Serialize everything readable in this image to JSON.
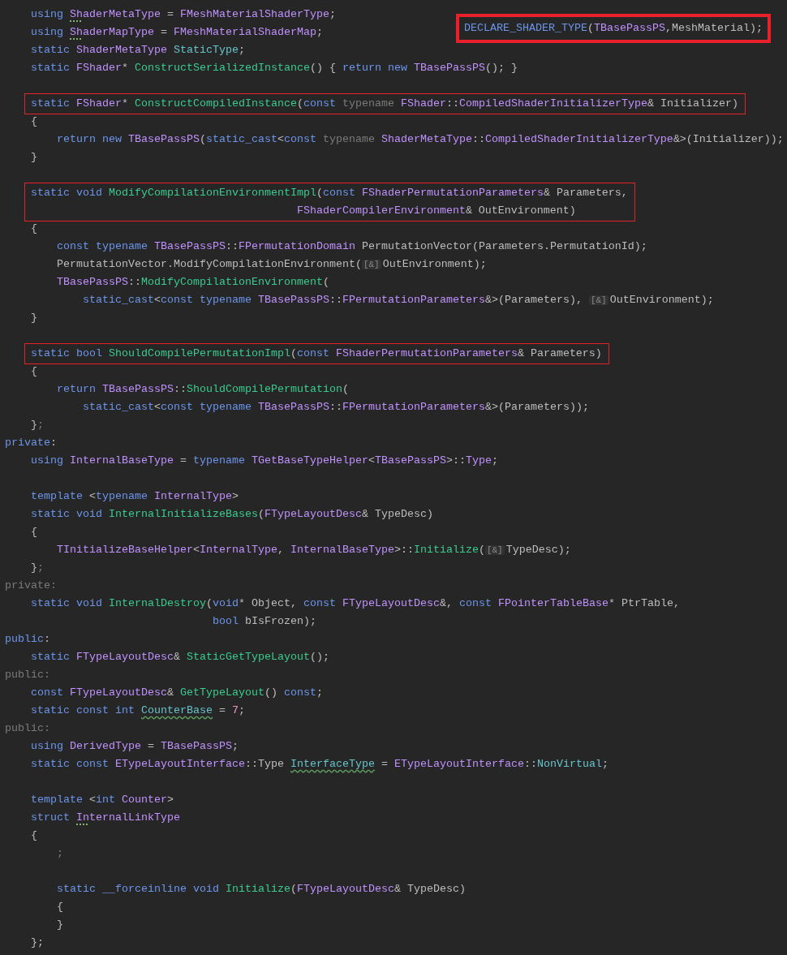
{
  "callout": {
    "tokens": [
      {
        "kind": "macro",
        "text": "DECLARE_SHADER_TYPE"
      },
      {
        "kind": "plain",
        "text": "("
      },
      {
        "kind": "type",
        "text": "TBasePassPS"
      },
      {
        "kind": "plain",
        "text": ",MeshMaterial);"
      }
    ]
  },
  "blocks": [
    {
      "boxed": false,
      "lines": [
        {
          "kind": "code",
          "tokens": [
            {
              "kind": "kw",
              "text": "    using "
            },
            {
              "kind": "type_dotted",
              "text": "Sh"
            },
            {
              "kind": "type",
              "text": "aderMetaType"
            },
            {
              "kind": "plain",
              "text": " = "
            },
            {
              "kind": "type",
              "text": "FMeshMaterialShaderType"
            },
            {
              "kind": "plain",
              "text": ";"
            }
          ]
        },
        {
          "kind": "code",
          "tokens": [
            {
              "kind": "kw",
              "text": "    using "
            },
            {
              "kind": "type_dotted",
              "text": "Sh"
            },
            {
              "kind": "type",
              "text": "aderMapType"
            },
            {
              "kind": "plain",
              "text": " = "
            },
            {
              "kind": "type",
              "text": "FMeshMaterialShaderMap"
            },
            {
              "kind": "plain",
              "text": ";"
            }
          ]
        },
        {
          "kind": "code",
          "tokens": [
            {
              "kind": "kw",
              "text": "    static "
            },
            {
              "kind": "type",
              "text": "ShaderMetaType "
            },
            {
              "kind": "field",
              "text": "StaticType"
            },
            {
              "kind": "plain",
              "text": ";"
            }
          ]
        },
        {
          "kind": "code",
          "tokens": [
            {
              "kind": "kw",
              "text": "    static "
            },
            {
              "kind": "type",
              "text": "FShader"
            },
            {
              "kind": "plain",
              "text": "* "
            },
            {
              "kind": "fn",
              "text": "ConstructSerializedInstance"
            },
            {
              "kind": "plain",
              "text": "() { "
            },
            {
              "kind": "kw",
              "text": "return new "
            },
            {
              "kind": "type",
              "text": "TBasePassPS"
            },
            {
              "kind": "plain",
              "text": "(); }"
            }
          ]
        },
        {
          "kind": "blank"
        }
      ]
    },
    {
      "boxed": true,
      "lines": [
        {
          "kind": "code",
          "tokens": [
            {
              "kind": "kw",
              "text": "    static "
            },
            {
              "kind": "type",
              "text": "FShader"
            },
            {
              "kind": "plain",
              "text": "* "
            },
            {
              "kind": "fn",
              "text": "ConstructCompiledInstance"
            },
            {
              "kind": "plain",
              "text": "("
            },
            {
              "kind": "kw",
              "text": "const "
            },
            {
              "kind": "dim",
              "text": "typename "
            },
            {
              "kind": "type",
              "text": "FShader"
            },
            {
              "kind": "plain",
              "text": "::"
            },
            {
              "kind": "type",
              "text": "CompiledShaderInitializerType"
            },
            {
              "kind": "plain",
              "text": "& Initializer)"
            }
          ]
        }
      ]
    },
    {
      "boxed": false,
      "lines": [
        {
          "kind": "code",
          "tokens": [
            {
              "kind": "plain",
              "text": "    {"
            }
          ]
        },
        {
          "kind": "code",
          "tokens": [
            {
              "kind": "kw",
              "text": "        return new "
            },
            {
              "kind": "type",
              "text": "TBasePassPS"
            },
            {
              "kind": "plain",
              "text": "("
            },
            {
              "kind": "kw",
              "text": "static_cast"
            },
            {
              "kind": "plain",
              "text": "<"
            },
            {
              "kind": "kw",
              "text": "const "
            },
            {
              "kind": "dim",
              "text": "typename "
            },
            {
              "kind": "type",
              "text": "ShaderMetaType"
            },
            {
              "kind": "plain",
              "text": "::"
            },
            {
              "kind": "type",
              "text": "CompiledShaderInitializerType"
            },
            {
              "kind": "plain",
              "text": "&>(Initializer));"
            }
          ]
        },
        {
          "kind": "code",
          "tokens": [
            {
              "kind": "plain",
              "text": "    }"
            }
          ]
        },
        {
          "kind": "blank"
        }
      ]
    },
    {
      "boxed": true,
      "lines": [
        {
          "kind": "code",
          "tokens": [
            {
              "kind": "kw",
              "text": "    static void "
            },
            {
              "kind": "fn",
              "text": "ModifyCompilationEnvironmentImpl"
            },
            {
              "kind": "plain",
              "text": "("
            },
            {
              "kind": "kw",
              "text": "const "
            },
            {
              "kind": "type",
              "text": "FShaderPermutationParameters"
            },
            {
              "kind": "plain",
              "text": "& Parameters,"
            }
          ]
        },
        {
          "kind": "code",
          "tokens": [
            {
              "kind": "type",
              "text": "                                             FShaderCompilerEnvironment"
            },
            {
              "kind": "plain",
              "text": "& OutEnvironment)"
            }
          ]
        }
      ]
    },
    {
      "boxed": false,
      "lines": [
        {
          "kind": "code",
          "tokens": [
            {
              "kind": "plain",
              "text": "    {"
            }
          ]
        },
        {
          "kind": "code",
          "tokens": [
            {
              "kind": "kw",
              "text": "        const typename "
            },
            {
              "kind": "type",
              "text": "TBasePassPS"
            },
            {
              "kind": "plain",
              "text": "::"
            },
            {
              "kind": "type",
              "text": "FPermutationDomain"
            },
            {
              "kind": "plain",
              "text": " PermutationVector(Parameters.PermutationId);"
            }
          ]
        },
        {
          "kind": "code",
          "tokens": [
            {
              "kind": "plain",
              "text": "        PermutationVector.ModifyCompilationEnvironment("
            },
            {
              "kind": "hint",
              "text": "[&]"
            },
            {
              "kind": "plain",
              "text": "OutEnvironment);"
            }
          ]
        },
        {
          "kind": "code",
          "tokens": [
            {
              "kind": "type",
              "text": "        TBasePassPS"
            },
            {
              "kind": "plain",
              "text": "::"
            },
            {
              "kind": "fn",
              "text": "ModifyCompilationEnvironment"
            },
            {
              "kind": "plain",
              "text": "("
            }
          ]
        },
        {
          "kind": "code",
          "tokens": [
            {
              "kind": "kw",
              "text": "            static_cast"
            },
            {
              "kind": "plain",
              "text": "<"
            },
            {
              "kind": "kw",
              "text": "const typename "
            },
            {
              "kind": "type",
              "text": "TBasePassPS"
            },
            {
              "kind": "plain",
              "text": "::"
            },
            {
              "kind": "type",
              "text": "FPermutationParameters"
            },
            {
              "kind": "plain",
              "text": "&>(Parameters), "
            },
            {
              "kind": "hint",
              "text": "[&]"
            },
            {
              "kind": "plain",
              "text": "OutEnvironment);"
            }
          ]
        },
        {
          "kind": "code",
          "tokens": [
            {
              "kind": "plain",
              "text": "    }"
            }
          ]
        },
        {
          "kind": "blank"
        }
      ]
    },
    {
      "boxed": true,
      "lines": [
        {
          "kind": "code",
          "tokens": [
            {
              "kind": "kw",
              "text": "    static bool "
            },
            {
              "kind": "fn",
              "text": "ShouldCompilePermutationImpl"
            },
            {
              "kind": "plain",
              "text": "("
            },
            {
              "kind": "kw",
              "text": "const "
            },
            {
              "kind": "type",
              "text": "FShaderPermutationParameters"
            },
            {
              "kind": "plain",
              "text": "& Parameters)"
            }
          ]
        }
      ]
    },
    {
      "boxed": false,
      "lines": [
        {
          "kind": "code",
          "tokens": [
            {
              "kind": "plain",
              "text": "    {"
            }
          ]
        },
        {
          "kind": "code",
          "tokens": [
            {
              "kind": "kw",
              "text": "        return "
            },
            {
              "kind": "type",
              "text": "TBasePassPS"
            },
            {
              "kind": "plain",
              "text": "::"
            },
            {
              "kind": "fn",
              "text": "ShouldCompilePermutation"
            },
            {
              "kind": "plain",
              "text": "("
            }
          ]
        },
        {
          "kind": "code",
          "tokens": [
            {
              "kind": "kw",
              "text": "            static_cast"
            },
            {
              "kind": "plain",
              "text": "<"
            },
            {
              "kind": "kw",
              "text": "const typename "
            },
            {
              "kind": "type",
              "text": "TBasePassPS"
            },
            {
              "kind": "plain",
              "text": "::"
            },
            {
              "kind": "type",
              "text": "FPermutationParameters"
            },
            {
              "kind": "plain",
              "text": "&>(Parameters));"
            }
          ]
        },
        {
          "kind": "code",
          "tokens": [
            {
              "kind": "plain",
              "text": "    }"
            },
            {
              "kind": "dim",
              "text": ";"
            }
          ]
        },
        {
          "kind": "code",
          "tokens": [
            {
              "kind": "kw",
              "text": "private"
            },
            {
              "kind": "plain",
              "text": ":"
            }
          ]
        },
        {
          "kind": "code",
          "tokens": [
            {
              "kind": "kw",
              "text": "    using "
            },
            {
              "kind": "type",
              "text": "InternalBaseType"
            },
            {
              "kind": "plain",
              "text": " = "
            },
            {
              "kind": "kw",
              "text": "typename "
            },
            {
              "kind": "type",
              "text": "TGetBaseTypeHelper"
            },
            {
              "kind": "plain",
              "text": "<"
            },
            {
              "kind": "type",
              "text": "TBasePassPS"
            },
            {
              "kind": "plain",
              "text": ">::"
            },
            {
              "kind": "type",
              "text": "Type"
            },
            {
              "kind": "plain",
              "text": ";"
            }
          ]
        },
        {
          "kind": "blank"
        },
        {
          "kind": "code",
          "tokens": [
            {
              "kind": "kw",
              "text": "    template "
            },
            {
              "kind": "plain",
              "text": "<"
            },
            {
              "kind": "kw",
              "text": "typename "
            },
            {
              "kind": "type",
              "text": "InternalType"
            },
            {
              "kind": "plain",
              "text": ">"
            }
          ]
        },
        {
          "kind": "code",
          "tokens": [
            {
              "kind": "kw",
              "text": "    static void "
            },
            {
              "kind": "fn",
              "text": "InternalInitializeBases"
            },
            {
              "kind": "plain",
              "text": "("
            },
            {
              "kind": "type",
              "text": "FTypeLayoutDesc"
            },
            {
              "kind": "plain",
              "text": "& TypeDesc)"
            }
          ]
        },
        {
          "kind": "code",
          "tokens": [
            {
              "kind": "plain",
              "text": "    {"
            }
          ]
        },
        {
          "kind": "code",
          "tokens": [
            {
              "kind": "type",
              "text": "        TInitializeBaseHelper"
            },
            {
              "kind": "plain",
              "text": "<"
            },
            {
              "kind": "type",
              "text": "InternalType"
            },
            {
              "kind": "plain",
              "text": ", "
            },
            {
              "kind": "type",
              "text": "InternalBaseType"
            },
            {
              "kind": "plain",
              "text": ">::"
            },
            {
              "kind": "fn",
              "text": "Initialize"
            },
            {
              "kind": "plain",
              "text": "("
            },
            {
              "kind": "hint",
              "text": "[&]"
            },
            {
              "kind": "plain",
              "text": "TypeDesc);"
            }
          ]
        },
        {
          "kind": "code",
          "tokens": [
            {
              "kind": "plain",
              "text": "    }"
            },
            {
              "kind": "dim",
              "text": ";"
            }
          ]
        },
        {
          "kind": "code",
          "tokens": [
            {
              "kind": "dim",
              "text": "private:"
            }
          ]
        },
        {
          "kind": "code",
          "tokens": [
            {
              "kind": "kw",
              "text": "    static void "
            },
            {
              "kind": "fn",
              "text": "InternalDestroy"
            },
            {
              "kind": "plain",
              "text": "("
            },
            {
              "kind": "kw",
              "text": "void"
            },
            {
              "kind": "plain",
              "text": "* Object, "
            },
            {
              "kind": "kw",
              "text": "const "
            },
            {
              "kind": "type",
              "text": "FTypeLayoutDesc"
            },
            {
              "kind": "plain",
              "text": "&, "
            },
            {
              "kind": "kw",
              "text": "const "
            },
            {
              "kind": "type",
              "text": "FPointerTableBase"
            },
            {
              "kind": "plain",
              "text": "* PtrTable,"
            }
          ]
        },
        {
          "kind": "code",
          "tokens": [
            {
              "kind": "kw",
              "text": "                                bool"
            },
            {
              "kind": "plain",
              "text": " bIsFrozen);"
            }
          ]
        },
        {
          "kind": "code",
          "tokens": [
            {
              "kind": "kw",
              "text": "public"
            },
            {
              "kind": "plain",
              "text": ":"
            }
          ]
        },
        {
          "kind": "code",
          "tokens": [
            {
              "kind": "kw",
              "text": "    static "
            },
            {
              "kind": "type",
              "text": "FTypeLayoutDesc"
            },
            {
              "kind": "plain",
              "text": "& "
            },
            {
              "kind": "fn",
              "text": "StaticGetTypeLayout"
            },
            {
              "kind": "plain",
              "text": "();"
            }
          ]
        },
        {
          "kind": "code",
          "tokens": [
            {
              "kind": "dim",
              "text": "public:"
            }
          ]
        },
        {
          "kind": "code",
          "tokens": [
            {
              "kind": "kw",
              "text": "    const "
            },
            {
              "kind": "type",
              "text": "FTypeLayoutDesc"
            },
            {
              "kind": "plain",
              "text": "& "
            },
            {
              "kind": "fn",
              "text": "GetTypeLayout"
            },
            {
              "kind": "plain",
              "text": "() "
            },
            {
              "kind": "kw",
              "text": "const"
            },
            {
              "kind": "plain",
              "text": ";"
            }
          ]
        },
        {
          "kind": "code",
          "tokens": [
            {
              "kind": "kw",
              "text": "    static const int "
            },
            {
              "kind": "field_wavy",
              "text": "CounterBase"
            },
            {
              "kind": "plain",
              "text": " = "
            },
            {
              "kind": "num",
              "text": "7"
            },
            {
              "kind": "plain",
              "text": ";"
            }
          ]
        },
        {
          "kind": "code",
          "tokens": [
            {
              "kind": "dim",
              "text": "public:"
            }
          ]
        },
        {
          "kind": "code",
          "tokens": [
            {
              "kind": "kw",
              "text": "    using "
            },
            {
              "kind": "type",
              "text": "DerivedType"
            },
            {
              "kind": "plain",
              "text": " = "
            },
            {
              "kind": "type",
              "text": "TBasePassPS"
            },
            {
              "kind": "plain",
              "text": ";"
            }
          ]
        },
        {
          "kind": "code",
          "tokens": [
            {
              "kind": "kw",
              "text": "    static const "
            },
            {
              "kind": "type",
              "text": "ETypeLayoutInterface"
            },
            {
              "kind": "plain",
              "text": "::Type "
            },
            {
              "kind": "field_wavy",
              "text": "InterfaceType"
            },
            {
              "kind": "plain",
              "text": " = "
            },
            {
              "kind": "type",
              "text": "ETypeLayoutInterface"
            },
            {
              "kind": "plain",
              "text": "::"
            },
            {
              "kind": "field",
              "text": "NonVirtual"
            },
            {
              "kind": "plain",
              "text": ";"
            }
          ]
        },
        {
          "kind": "blank"
        },
        {
          "kind": "code",
          "tokens": [
            {
              "kind": "kw",
              "text": "    template "
            },
            {
              "kind": "plain",
              "text": "<"
            },
            {
              "kind": "kw",
              "text": "int "
            },
            {
              "kind": "type",
              "text": "Counter"
            },
            {
              "kind": "plain",
              "text": ">"
            }
          ]
        },
        {
          "kind": "code",
          "tokens": [
            {
              "kind": "kw",
              "text": "    struct "
            },
            {
              "kind": "type_dotted",
              "text": "In"
            },
            {
              "kind": "type",
              "text": "ternalLinkType"
            }
          ]
        },
        {
          "kind": "code",
          "tokens": [
            {
              "kind": "plain",
              "text": "    {"
            }
          ]
        },
        {
          "kind": "code",
          "tokens": [
            {
              "kind": "dim",
              "text": "        ;"
            }
          ]
        },
        {
          "kind": "blank"
        },
        {
          "kind": "code",
          "tokens": [
            {
              "kind": "kw",
              "text": "        static __forceinline void "
            },
            {
              "kind": "fn",
              "text": "Initialize"
            },
            {
              "kind": "plain",
              "text": "("
            },
            {
              "kind": "type",
              "text": "FTypeLayoutDesc"
            },
            {
              "kind": "plain",
              "text": "& TypeDesc)"
            }
          ]
        },
        {
          "kind": "code",
          "tokens": [
            {
              "kind": "plain",
              "text": "        {"
            }
          ]
        },
        {
          "kind": "code",
          "tokens": [
            {
              "kind": "plain",
              "text": "        }"
            }
          ]
        },
        {
          "kind": "code",
          "tokens": [
            {
              "kind": "plain",
              "text": "    };"
            }
          ]
        }
      ]
    }
  ]
}
